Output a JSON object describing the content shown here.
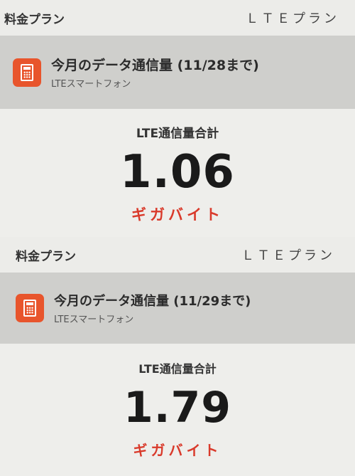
{
  "blocks": [
    {
      "plan_label": "料金プラン",
      "plan_value": "ＬＴＥプラン",
      "usage_title": "今月のデータ通信量 (11/28まで)",
      "usage_subtitle": "LTEスマートフォン",
      "total_label": "LTE通信量合計",
      "total_value": "1.06",
      "total_unit": "ギガバイト"
    },
    {
      "plan_label": "料金プラン",
      "plan_value": "ＬＴＥプラン",
      "usage_title": "今月のデータ通信量 (11/29まで)",
      "usage_subtitle": "LTEスマートフォン",
      "total_label": "LTE通信量合計",
      "total_value": "1.79",
      "total_unit": "ギガバイト"
    }
  ],
  "icons": {
    "app": "calculator-icon"
  },
  "colors": {
    "icon_bg": "#e8552c",
    "unit_text": "#d93a2b"
  }
}
